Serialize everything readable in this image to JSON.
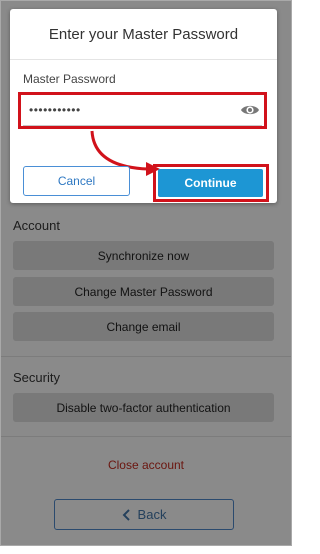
{
  "modal": {
    "title": "Enter your Master Password",
    "field_label": "Master Password",
    "password_value": "•••••••••••",
    "cancel_label": "Cancel",
    "continue_label": "Continue"
  },
  "account": {
    "title": "Account",
    "buttons": [
      "Synchronize now",
      "Change Master Password",
      "Change email"
    ]
  },
  "security": {
    "title": "Security",
    "buttons": [
      "Disable two-factor authentication"
    ]
  },
  "close_account": "Close account",
  "back_label": "Back",
  "colors": {
    "highlight": "#d1121b",
    "primary": "#1d96d4",
    "danger": "#b8291e"
  }
}
